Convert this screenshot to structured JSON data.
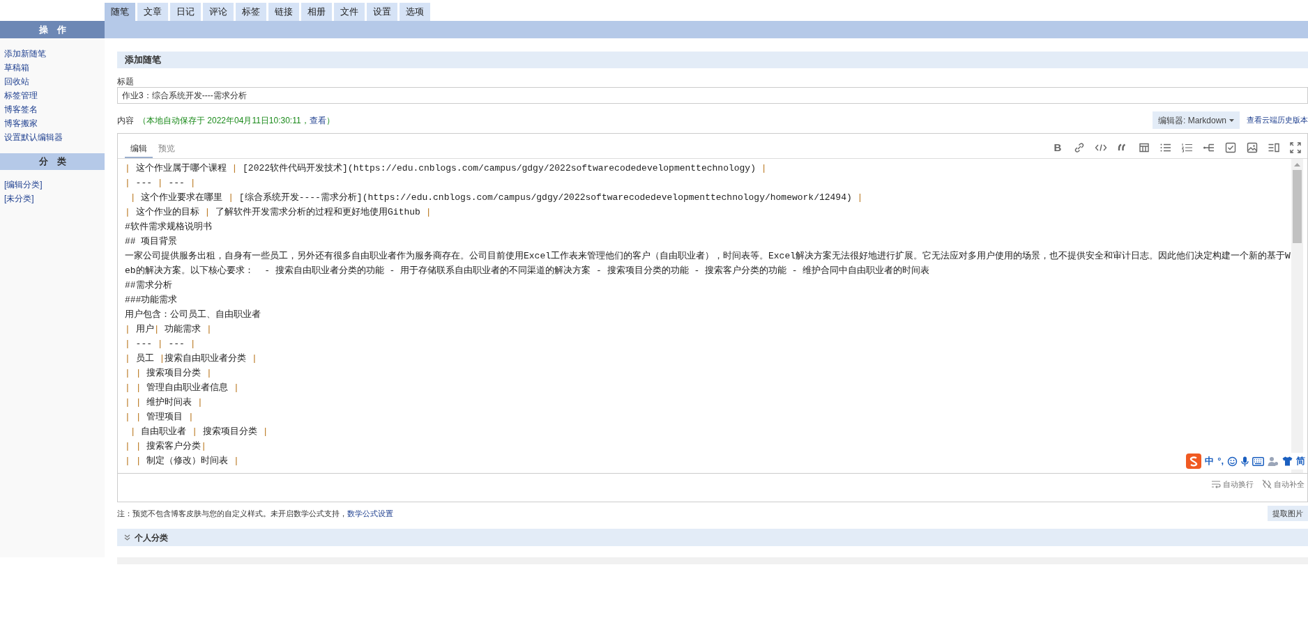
{
  "tabs": [
    {
      "label": "随笔",
      "selected": true
    },
    {
      "label": "文章",
      "selected": false
    },
    {
      "label": "日记",
      "selected": false
    },
    {
      "label": "评论",
      "selected": false
    },
    {
      "label": "标签",
      "selected": false
    },
    {
      "label": "链接",
      "selected": false
    },
    {
      "label": "相册",
      "selected": false
    },
    {
      "label": "文件",
      "selected": false
    },
    {
      "label": "设置",
      "selected": false
    },
    {
      "label": "选项",
      "selected": false
    }
  ],
  "sidebar": {
    "sections": [
      {
        "title": "操　作",
        "kind": "primary",
        "items": [
          "添加新随笔",
          "草稿箱",
          "回收站",
          "标签管理",
          "博客签名",
          "博客搬家",
          "设置默认编辑器"
        ]
      },
      {
        "title": "分　类",
        "kind": "secondary",
        "items": [
          "[编辑分类]",
          "[未分类]"
        ]
      }
    ]
  },
  "form": {
    "heading": "添加随笔",
    "title_label": "标题",
    "title_value": "作业3：综合系统开发----需求分析",
    "content_label": "内容",
    "autosave_prefix": "（本地自动保存于 2022年04月11日10:30:11，",
    "autosave_link": "查看",
    "autosave_suffix": "）",
    "editor_select": "编辑器: Markdown",
    "history_link": "查看云端历史版本"
  },
  "editor": {
    "tabs": [
      {
        "label": "编辑",
        "selected": true
      },
      {
        "label": "预览",
        "selected": false
      }
    ],
    "toolbar": [
      {
        "kind": "bold",
        "label": "B"
      },
      {
        "kind": "link"
      },
      {
        "kind": "code"
      },
      {
        "kind": "quote"
      },
      {
        "kind": "table"
      },
      {
        "kind": "bullets"
      },
      {
        "kind": "numbers"
      },
      {
        "kind": "indent"
      },
      {
        "kind": "checkbox"
      },
      {
        "kind": "image"
      },
      {
        "kind": "split"
      },
      {
        "kind": "fullscreen"
      }
    ],
    "lines": [
      "| 这个作业属于哪个课程 | [2022软件代码开发技术](https://edu.cnblogs.com/campus/gdgy/2022softwarecodedevelopmenttechnology) |",
      "| --- | --- |",
      " | 这个作业要求在哪里 | [综合系统开发----需求分析](https://edu.cnblogs.com/campus/gdgy/2022softwarecodedevelopmenttechnology/homework/12494) |",
      "| 这个作业的目标 | 了解软件开发需求分析的过程和更好地使用Github |",
      "#软件需求规格说明书",
      "## 项目背景",
      "一家公司提供服务出租，自身有一些员工，另外还有很多自由职业者作为服务商存在。公司目前使用Excel工作表来管理他们的客户（自由职业者），时间表等。Excel解决方案无法很好地进行扩展。它无法应对多用户使用的场景，也不提供安全和审计日志。因此他们决定构建一个新的基于Web的解决方案。以下核心要求：  - 搜索自由职业者分类的功能 - 用于存储联系自由职业者的不同渠道的解决方案 - 搜索项目分类的功能 - 搜索客户分类的功能 - 维护合同中自由职业者的时间表",
      "##需求分析",
      "###功能需求",
      "用户包含：公司员工、自由职业者",
      "| 用户| 功能需求 |",
      "| --- | --- |",
      "| 员工 |搜索自由职业者分类 |",
      "| | 搜索项目分类 |",
      "| | 管理自由职业者信息 |",
      "| | 维护时间表 |",
      "| | 管理项目 |",
      " | 自由职业者 | 搜索项目分类 |",
      "| | 搜索客户分类|",
      "| | 制定（修改）时间表 |"
    ],
    "options": [
      {
        "kind": "wrap",
        "label": "自动换行"
      },
      {
        "kind": "complete",
        "label": "自动补全"
      }
    ]
  },
  "ime": {
    "lang": "中",
    "punct": "°,",
    "mode": "简"
  },
  "note": {
    "text": "注：预览不包含博客皮肤与您的自定义样式。未开启数学公式支持，",
    "link": "数学公式设置"
  },
  "extract_button": "提取图片",
  "category_panel": "个人分类"
}
